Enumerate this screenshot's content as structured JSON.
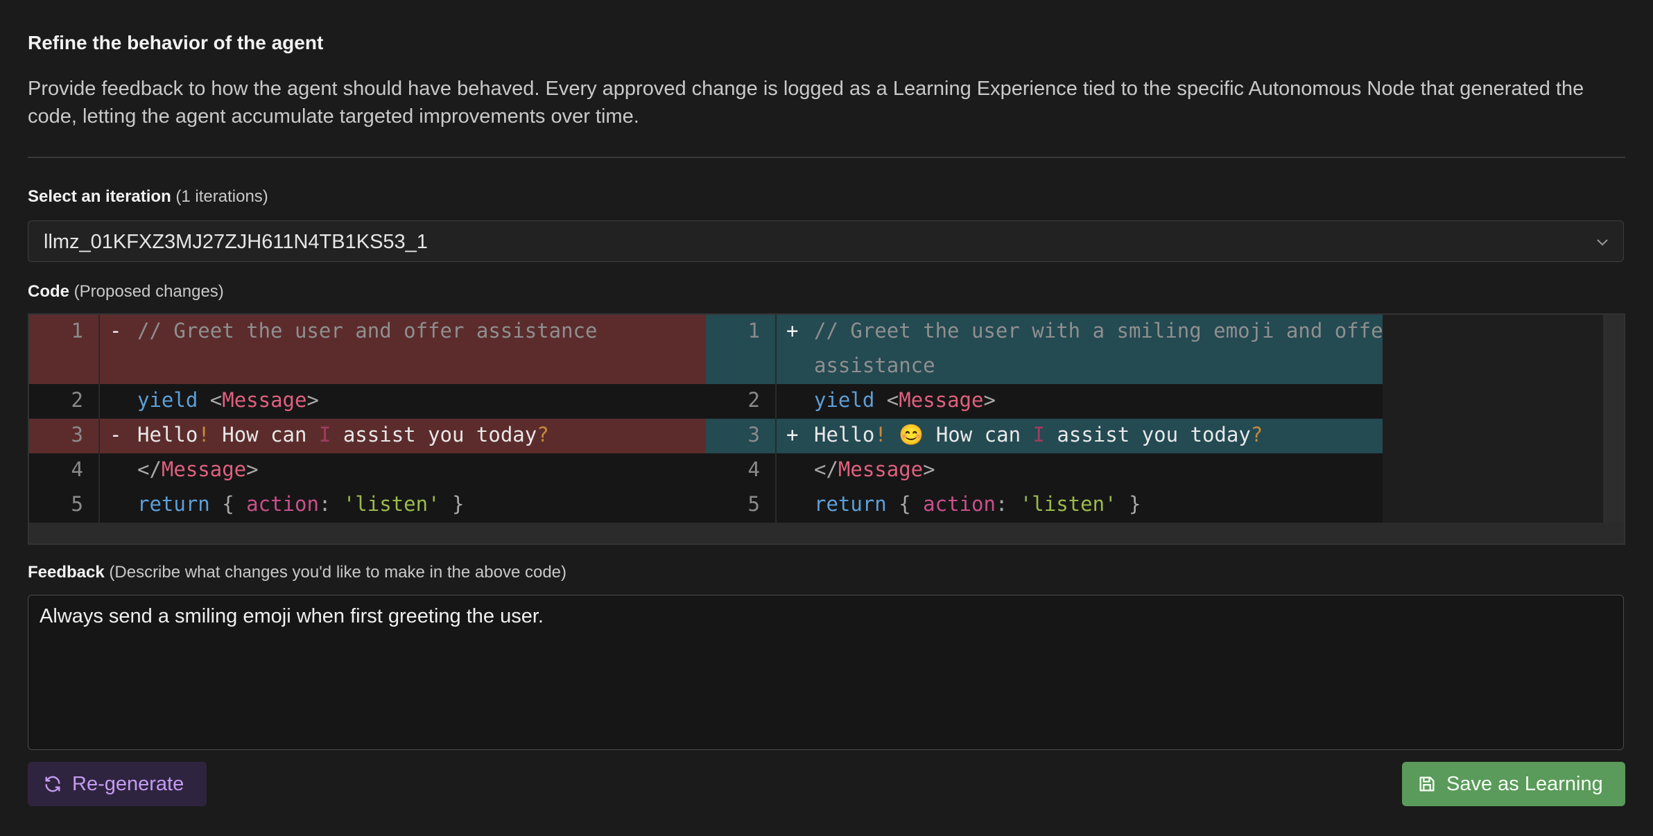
{
  "header": {
    "title": "Refine the behavior of the agent",
    "description": "Provide feedback to how the agent should have behaved. Every approved change is logged as a Learning Experience tied to the specific Autonomous Node that generated the code, letting the agent accumulate targeted improvements over time."
  },
  "iteration": {
    "label": "Select an iteration",
    "count_text": "(1 iterations)",
    "selected": "llmz_01KFXZ3MJ27ZJH611N4TB1KS53_1"
  },
  "code": {
    "label": "Code",
    "sublabel": "(Proposed changes)",
    "left_lines": [
      {
        "n": "1",
        "sign": "-",
        "comment": "// Greet the user and offer assistance"
      },
      {
        "n": "2",
        "yield": "yield",
        "lt": "<",
        "tag": "Message",
        "gt": ">"
      },
      {
        "n": "3",
        "sign": "-",
        "w1": "Hello",
        "p1": "!",
        "w2": " How can ",
        "p2": "I",
        "w3": " assist you today",
        "p3": "?"
      },
      {
        "n": "4",
        "open": "</",
        "tag": "Message",
        "gt": ">"
      },
      {
        "n": "5",
        "ret": "return",
        "b1": " { ",
        "key": "action",
        "colon": ": ",
        "str": "'listen'",
        "b2": " }"
      }
    ],
    "right_lines": [
      {
        "n": "1",
        "sign": "+",
        "comment1": "// Greet the user with a smiling emoji and offer",
        "comment2": "assistance"
      },
      {
        "n": "2",
        "yield": "yield",
        "lt": "<",
        "tag": "Message",
        "gt": ">"
      },
      {
        "n": "3",
        "sign": "+",
        "w1": "Hello",
        "p1": "!",
        "emoji": " 😊",
        "w2": " How can ",
        "p2": "I",
        "w3": " assist you today",
        "p3": "?"
      },
      {
        "n": "4",
        "open": "</",
        "tag": "Message",
        "gt": ">"
      },
      {
        "n": "5",
        "ret": "return",
        "b1": " { ",
        "key": "action",
        "colon": ": ",
        "str": "'listen'",
        "b2": " }"
      }
    ]
  },
  "feedback": {
    "label": "Feedback",
    "sublabel": "(Describe what changes you'd like to make in the above code)",
    "value": "Always send a smiling emoji when first greeting the user."
  },
  "actions": {
    "regenerate_label": "Re-generate",
    "save_label": "Save as Learning"
  },
  "icons": {
    "chevron": "chevron-down-icon",
    "regenerate": "refresh-icon",
    "save": "save-disk-icon"
  },
  "colors": {
    "removed_bg": "#5c2c2c",
    "added_bg": "#244a52",
    "regenerate_bg": "#2f2440",
    "save_bg": "#5a9a5a"
  }
}
